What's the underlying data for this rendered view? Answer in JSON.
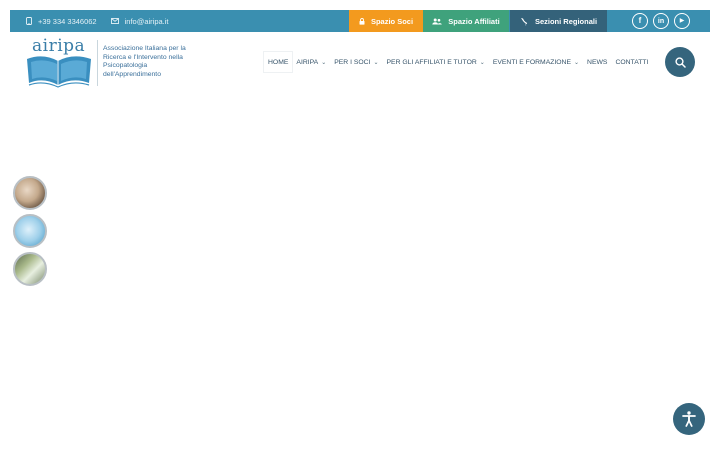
{
  "topbar": {
    "phone": "+39 334 3346062",
    "email": "info@airipa.it",
    "spazio_soci": "Spazio Soci",
    "spazio_affiliati": "Spazio Affiliati",
    "sezioni_regionali": "Sezioni Regionali",
    "colors": {
      "bar": "#3a8fb0",
      "soci": "#f39a1e",
      "affiliati": "#3fa27c",
      "regionali": "#34627a"
    }
  },
  "social": {
    "facebook": "f",
    "linkedin": "in",
    "youtube": "▶"
  },
  "brand": {
    "logo_text": "airipa",
    "tagline": "Associazione Italiana per la Ricerca e l'Intervento nella Psicopatologia dell'Apprendimento"
  },
  "nav": {
    "items": [
      {
        "label": "HOME",
        "has_dropdown": false
      },
      {
        "label": "AIRIPA",
        "has_dropdown": true
      },
      {
        "label": "PER I SOCI",
        "has_dropdown": true
      },
      {
        "label": "PER GLI AFFILIATI E TUTOR",
        "has_dropdown": true
      },
      {
        "label": "EVENTI E FORMAZIONE",
        "has_dropdown": true
      },
      {
        "label": "NEWS",
        "has_dropdown": false
      },
      {
        "label": "CONTATTI",
        "has_dropdown": false
      }
    ],
    "chevron": "⌄"
  },
  "icons": {
    "search": "search-icon",
    "accessibility": "accessibility-icon"
  }
}
